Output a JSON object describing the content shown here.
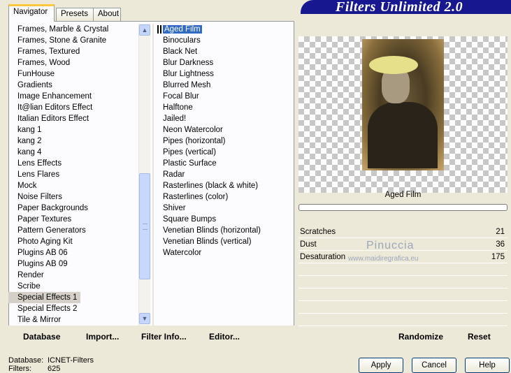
{
  "banner_title": "Filters Unlimited 2.0",
  "tabs": [
    "Navigator",
    "Presets",
    "About"
  ],
  "categories": [
    "Frames, Marble & Crystal",
    "Frames, Stone & Granite",
    "Frames, Textured",
    "Frames, Wood",
    "FunHouse",
    "Gradients",
    "Image Enhancement",
    "It@lian Editors Effect",
    "Italian Editors Effect",
    "kang 1",
    "kang 2",
    "kang 4",
    "Lens Effects",
    "Lens Flares",
    "Mock",
    "Noise Filters",
    "Paper Backgrounds",
    "Paper Textures",
    "Pattern Generators",
    "Photo Aging Kit",
    "Plugins AB 06",
    "Plugins AB 09",
    "Render",
    "Scribe",
    "Special Effects 1",
    "Special Effects 2",
    "Tile & Mirror"
  ],
  "selected_category": "Special Effects 1",
  "filters": [
    "Aged Film",
    "Binoculars",
    "Black Net",
    "Blur Darkness",
    "Blur Lightness",
    "Blurred Mesh",
    "Focal Blur",
    "Halftone",
    "Jailed!",
    "Neon Watercolor",
    "Pipes (horizontal)",
    "Pipes (vertical)",
    "Plastic Surface",
    "Radar",
    "Rasterlines (black & white)",
    "Rasterlines (color)",
    "Shiver",
    "Square Bumps",
    "Venetian Blinds (horizontal)",
    "Venetian Blinds (vertical)",
    "Watercolor"
  ],
  "selected_filter": "Aged Film",
  "bottom_buttons": {
    "database": "Database",
    "import": "Import...",
    "filter_info": "Filter Info...",
    "editor": "Editor..."
  },
  "preview": {
    "filter_title": "Aged Film",
    "progress": 0
  },
  "params": [
    {
      "name": "Scratches",
      "value": "21"
    },
    {
      "name": "Dust",
      "value": "36"
    },
    {
      "name": "Desaturation",
      "value": "175"
    }
  ],
  "watermark": {
    "line1": "Pinuccia",
    "line2": "www.maidiregrafica.eu"
  },
  "right_buttons": {
    "randomize": "Randomize",
    "reset": "Reset"
  },
  "status": {
    "database_label": "Database:",
    "database_value": "ICNET-Filters",
    "filters_label": "Filters:",
    "filters_value": "625"
  },
  "dialog_buttons": {
    "apply": "Apply",
    "cancel": "Cancel",
    "help": "Help"
  },
  "icons": {
    "scroll_up": "chevron-up-icon",
    "scroll_down": "chevron-down-icon"
  }
}
